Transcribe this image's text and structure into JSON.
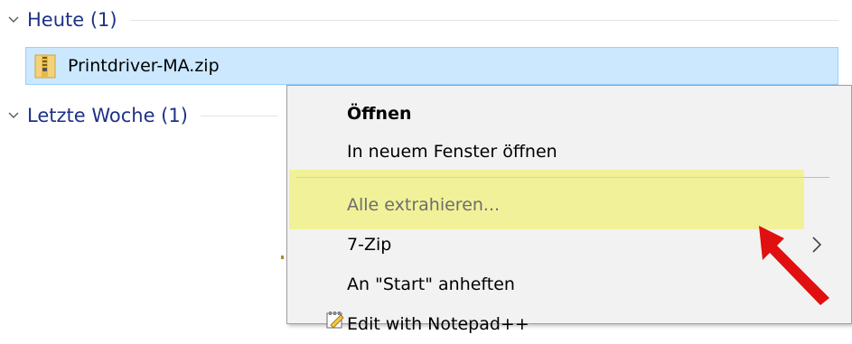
{
  "groups": [
    {
      "title": "Heute (1)"
    },
    {
      "title": "Letzte Woche (1)"
    }
  ],
  "file": {
    "name": "Printdriver-MA.zip"
  },
  "context_menu": {
    "items": [
      {
        "label": "Öffnen"
      },
      {
        "label": "In neuem Fenster öffnen"
      },
      {
        "label": "Alle extrahieren..."
      },
      {
        "label": "7-Zip"
      },
      {
        "label": "An \"Start\" anheften"
      },
      {
        "label": "Edit with Notepad++"
      }
    ]
  },
  "colors": {
    "group_title": "#1e3287",
    "selection_bg": "#cce8ff",
    "highlight": "#f0f050",
    "annotation_arrow": "#e01010"
  }
}
